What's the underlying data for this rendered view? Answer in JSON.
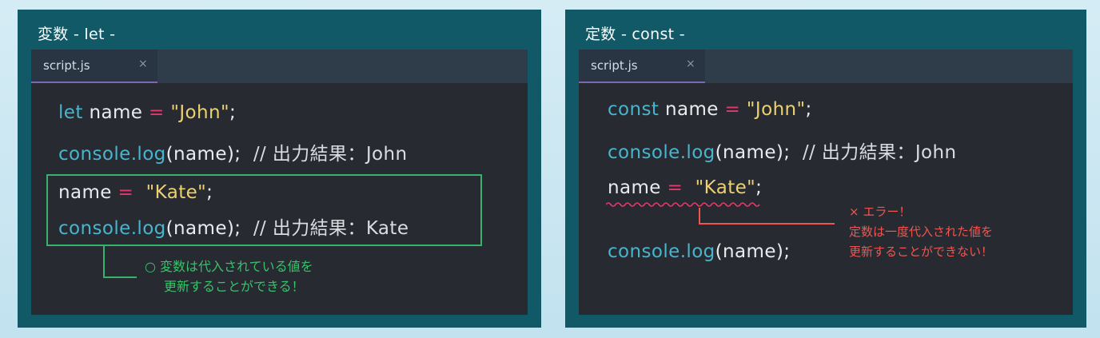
{
  "left_panel": {
    "title": "変数 - let -",
    "tab": {
      "label": "script.js",
      "close": "×"
    },
    "code": {
      "l1_kw": "let",
      "l1_name": " name ",
      "l1_op": "=",
      "l1_str": " \"John\"",
      "l1_end": ";",
      "l2_fn": "console.log",
      "l2_args": "(name);",
      "l2_cmt": "  // 出力結果：John",
      "l3_name": "name ",
      "l3_op": "=",
      "l3_str": "  \"Kate\"",
      "l3_end": ";",
      "l4_fn": "console.log",
      "l4_args": "(name);",
      "l4_cmt": "  // 出力結果：Kate"
    },
    "note": {
      "line1": "○ 変数は代入されている値を",
      "line2": "更新することができる！"
    }
  },
  "right_panel": {
    "title": "定数 - const -",
    "tab": {
      "label": "script.js",
      "close": "×"
    },
    "code": {
      "l1_kw": "const",
      "l1_name": " name ",
      "l1_op": "=",
      "l1_str": " \"John\"",
      "l1_end": ";",
      "l2_fn": "console.log",
      "l2_args": "(name);",
      "l2_cmt": "  // 出力結果：John",
      "l3_name": "name ",
      "l3_op": "=",
      "l3_str": "  \"Kate\"",
      "l3_end": ";",
      "l4_fn": "console.log",
      "l4_args": "(name);"
    },
    "note": {
      "line1": "× エラー！",
      "line2": "定数は一度代入された値を",
      "line3": "更新することができない！"
    }
  },
  "colors": {
    "panel_bg": "#115966",
    "editor_bg": "#272a30",
    "keyword": "#47b5ce",
    "operator": "#e5396b",
    "string": "#ecd171",
    "ok_green": "#37b26a",
    "error_red": "#f05650",
    "tab_underline": "#7d66b7"
  }
}
